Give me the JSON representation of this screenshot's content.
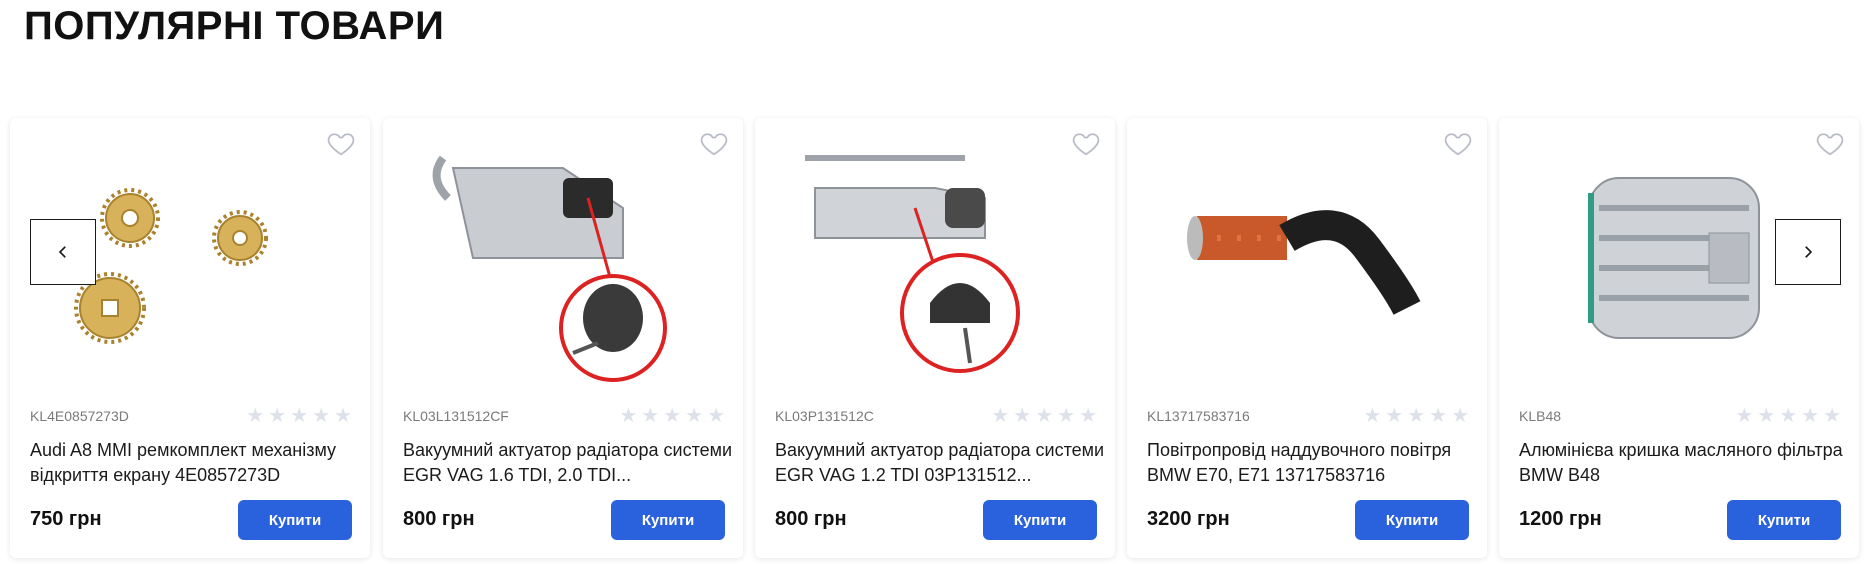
{
  "section": {
    "title": "ПОПУЛЯРНІ ТОВАРИ"
  },
  "nav": {
    "prev_icon": "chevron-left-icon",
    "next_icon": "chevron-right-icon"
  },
  "colors": {
    "accent": "#2a62dd",
    "star_empty": "#dde1ea",
    "text": "#1b1b1b"
  },
  "rating_max": 5,
  "products": [
    {
      "sku": "KL4E0857273D",
      "name": "Audi A8 MMI ремкомплект механізму відкриття екрану 4E0857273D",
      "price": "750 грн",
      "buy_label": "Купити",
      "rating": 0,
      "image": "gears"
    },
    {
      "sku": "KL03L131512CF",
      "name": "Вакуумний актуатор радіатора системи EGR VAG 1.6 TDI, 2.0 TDI...",
      "price": "800 грн",
      "buy_label": "Купити",
      "rating": 0,
      "image": "egr-valve"
    },
    {
      "sku": "KL03P131512C",
      "name": "Вакуумний актуатор радіатора системи EGR VAG 1.2 TDI 03P131512...",
      "price": "800 грн",
      "buy_label": "Купити",
      "rating": 0,
      "image": "egr-valve"
    },
    {
      "sku": "KL13717583716",
      "name": "Повітропровід наддувочного повітря BMW E70, E71 13717583716",
      "price": "3200 грн",
      "buy_label": "Купити",
      "rating": 0,
      "image": "air-hose"
    },
    {
      "sku": "KLB48",
      "name": "Алюмінієва кришка масляного фільтра BMW B48",
      "price": "1200 грн",
      "buy_label": "Купити",
      "rating": 0,
      "image": "filter-cap"
    }
  ]
}
